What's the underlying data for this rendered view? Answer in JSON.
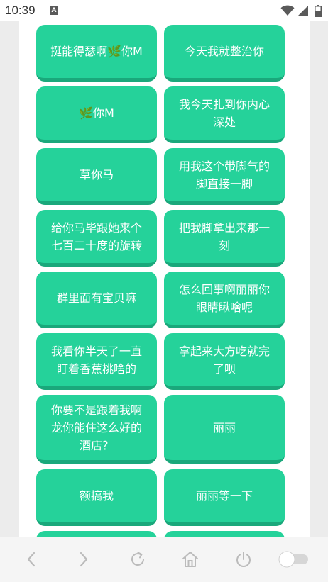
{
  "status_bar": {
    "time": "10:39",
    "notification_letter": "A",
    "icons": [
      "wifi-icon",
      "cell-signal-icon",
      "battery-icon"
    ]
  },
  "colors": {
    "background": "#ececec",
    "card": "#ffffff",
    "button": "#25d29a",
    "button_shadow": "#1aa87b",
    "button_text": "#ffffff",
    "nav_icon": "#bbbbbb"
  },
  "buttons": [
    "挺能得瑟啊🌿你M",
    "今天我就整治你",
    "🌿你M",
    "我今天扎到你内心深处",
    "草你马",
    "用我这个带脚气的脚直接一脚",
    "给你马毕跟她来个七百二十度的旋转",
    "把我脚拿出来那一刻",
    "群里面有宝贝嘛",
    "怎么回事啊丽丽你眼睛瞅啥呢",
    "我看你半天了一直盯着香蕉桃啥的",
    "拿起来大方吃就完了呗",
    "你要不是跟着我啊龙你能住这么好的酒店？",
    "丽丽",
    "额搞我",
    "丽丽等一下"
  ],
  "bottom_nav": {
    "items": [
      "back-icon",
      "forward-icon",
      "reload-icon",
      "home-icon",
      "power-icon",
      "toggle-switch"
    ]
  }
}
